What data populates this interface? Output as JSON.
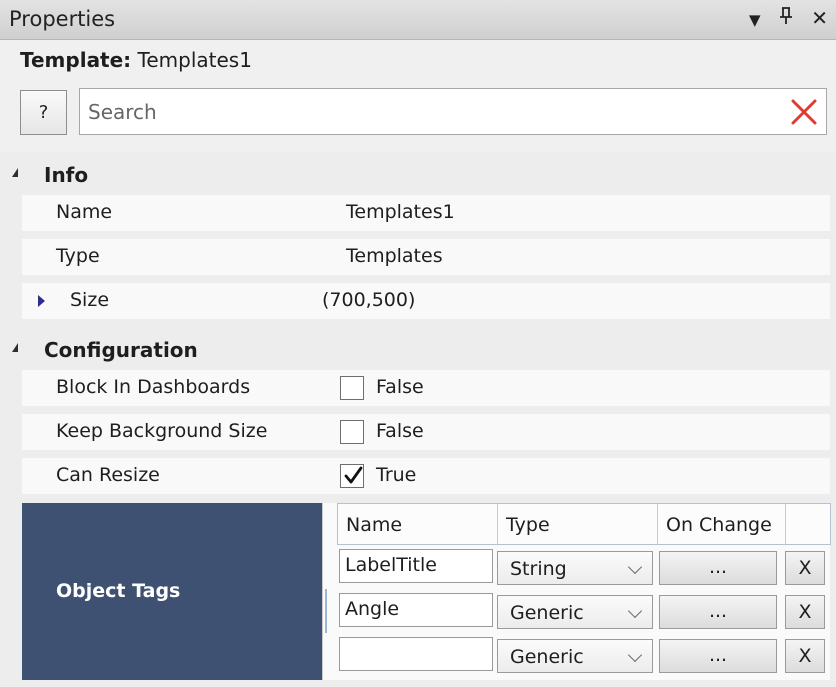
{
  "window": {
    "title": "Properties",
    "dropdown_icon": "▼",
    "pin_icon": "ꟼ",
    "close_icon": "✕"
  },
  "template": {
    "label": "Template:",
    "value": "Templates1"
  },
  "search": {
    "help_label": "?",
    "placeholder": "Search",
    "value": ""
  },
  "info": {
    "label": "Info",
    "rows": [
      {
        "label": "Name",
        "value": "Templates1"
      },
      {
        "label": "Type",
        "value": "Templates"
      },
      {
        "label": "Size",
        "value": "(700,500)"
      }
    ]
  },
  "configuration": {
    "label": "Configuration",
    "rows": [
      {
        "label": "Block In Dashboards",
        "value": "False",
        "checked": false
      },
      {
        "label": "Keep Background Size",
        "value": "False",
        "checked": false
      },
      {
        "label": "Can Resize",
        "value": "True",
        "checked": true
      }
    ]
  },
  "object_tags": {
    "label": "Object Tags",
    "columns": [
      "Name",
      "Type",
      "On Change"
    ],
    "rows": [
      {
        "name": "LabelTitle",
        "type": "String",
        "on_change": "...",
        "delete": "X"
      },
      {
        "name": "Angle",
        "type": "Generic",
        "on_change": "...",
        "delete": "X"
      },
      {
        "name": "",
        "type": "Generic",
        "on_change": "...",
        "delete": "X"
      }
    ]
  },
  "colors": {
    "accent": "#3f5172",
    "clear": "#e03c31",
    "expander": "#2b2e8f"
  }
}
